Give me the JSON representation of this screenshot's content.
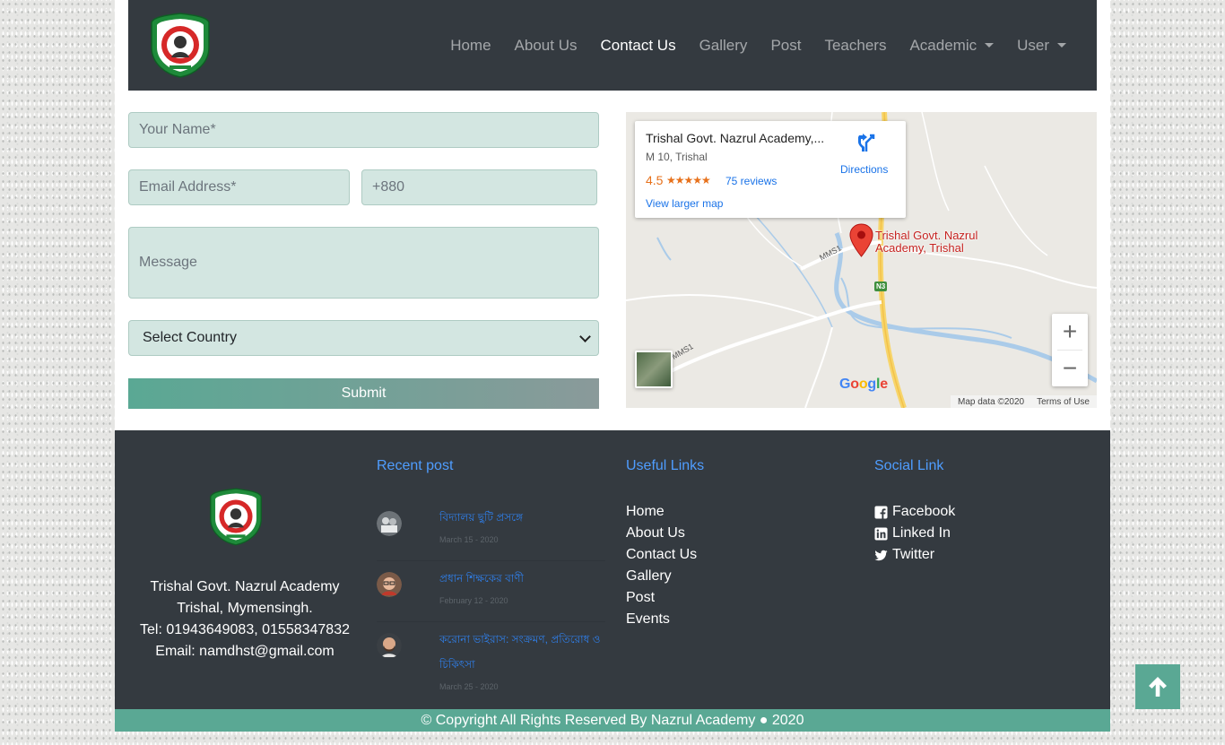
{
  "nav": {
    "items": [
      "Home",
      "About Us",
      "Contact Us",
      "Gallery",
      "Post",
      "Teachers",
      "Academic",
      "User"
    ],
    "active": "Contact Us"
  },
  "form": {
    "name_placeholder": "Your Name*",
    "email_placeholder": "Email Address*",
    "phone_placeholder": "+880",
    "message_placeholder": "Message",
    "country_selected": "Select Country",
    "submit_label": "Submit"
  },
  "map": {
    "place_name": "Trishal Govt. Nazrul Academy,...",
    "address": "M 10, Trishal",
    "rating": "4.5",
    "stars": "★★★★★",
    "reviews": "75 reviews",
    "larger_map": "View larger map",
    "directions": "Directions",
    "marker_label_1": "Trishal Govt. Nazrul",
    "marker_label_2": "Academy, Trishal",
    "road_1": "MMS1",
    "road_2": "MMS1",
    "road_3": "N3",
    "attribution": "Map data ©2020",
    "terms": "Terms of Use",
    "google": "Google"
  },
  "footer": {
    "address_lines": [
      "Trishal Govt. Nazrul Academy",
      "Trishal, Mymensingh.",
      "Tel: 01943649083, 01558347832",
      "Email: namdhst@gmail.com"
    ],
    "recent_heading": "Recent post",
    "useful_heading": "Useful Links",
    "social_heading": "Social Link",
    "posts": [
      {
        "title": "বিদ্যালয় ছুটি প্রসঙ্গে",
        "date": "March 15 - 2020"
      },
      {
        "title": "প্রধান শিক্ষকের বাণী",
        "date": "February 12 - 2020"
      },
      {
        "title": "করোনা ভাইরাস: সংক্রমণ, প্রতিরোধ ও চিকিৎসা",
        "date": "March 25 - 2020"
      }
    ],
    "useful_links": [
      "Home",
      "About Us",
      "Contact Us",
      "Gallery",
      "Post",
      "Events"
    ],
    "social_links": [
      {
        "label": "Facebook",
        "icon": "facebook-icon"
      },
      {
        "label": "Linked In",
        "icon": "linkedin-icon"
      },
      {
        "label": "Twitter",
        "icon": "twitter-icon"
      }
    ],
    "copyright": "© Copyright All Rights Reserved By Nazrul Academy ● 2020"
  },
  "colors": {
    "navbar": "#343a40",
    "accent": "#5aa894",
    "input_bg": "#d3e6e1",
    "link_blue": "#4f9dff"
  }
}
